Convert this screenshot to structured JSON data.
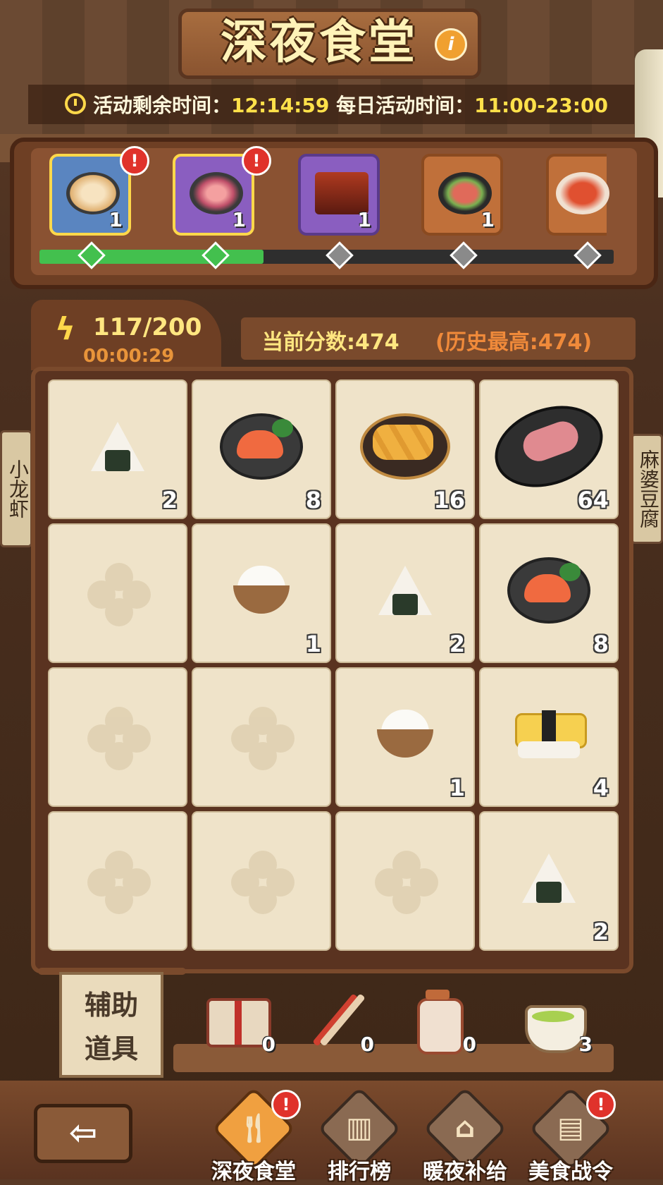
{
  "header": {
    "title": "深夜食堂"
  },
  "timer": {
    "remaining_label": "活动剩余时间：",
    "remaining_value": "12:14:59",
    "daily_label": "每日活动时间：",
    "daily_value": "11:00-23:00"
  },
  "progress": {
    "stages": [
      {
        "dish": "ramen-bowl-icon",
        "count": "1",
        "alert": true,
        "claimed": true
      },
      {
        "dish": "grilled-squid-icon",
        "count": "1",
        "alert": true,
        "claimed": true
      },
      {
        "dish": "unagi-box-icon",
        "count": "1",
        "alert": false,
        "claimed": false
      },
      {
        "dish": "sukiyaki-pot-icon",
        "count": "1",
        "alert": false,
        "claimed": false
      },
      {
        "dish": "lobster-platter-icon",
        "count": "",
        "alert": false,
        "claimed": false
      }
    ],
    "fill_fraction": 0.39
  },
  "energy": {
    "value": "117/200",
    "timer": "00:00:29"
  },
  "score": {
    "current": "当前分数:474",
    "best": "(历史最高:474)"
  },
  "grid": [
    [
      {
        "food": "onigiri-icon",
        "value": "2"
      },
      {
        "food": "salmon-sashimi-icon",
        "value": "8"
      },
      {
        "food": "shrimp-tempura-icon",
        "value": "16"
      },
      {
        "food": "grilled-squid-icon",
        "value": "64"
      }
    ],
    [
      {
        "food": "",
        "value": ""
      },
      {
        "food": "rice-bowl-icon",
        "value": "1"
      },
      {
        "food": "onigiri-icon",
        "value": "2"
      },
      {
        "food": "salmon-sashimi-icon",
        "value": "8"
      }
    ],
    [
      {
        "food": "",
        "value": ""
      },
      {
        "food": "",
        "value": ""
      },
      {
        "food": "rice-bowl-icon",
        "value": "1"
      },
      {
        "food": "tamago-sushi-icon",
        "value": "4"
      }
    ],
    [
      {
        "food": "",
        "value": ""
      },
      {
        "food": "",
        "value": ""
      },
      {
        "food": "",
        "value": ""
      },
      {
        "food": "onigiri-icon",
        "value": "2"
      }
    ]
  ],
  "tools": {
    "label_line1": "辅助",
    "label_line2": "道具",
    "items": [
      {
        "icon": "gift-box-icon",
        "count": "0"
      },
      {
        "icon": "chopsticks-icon",
        "count": "0"
      },
      {
        "icon": "seasoning-jar-icon",
        "count": "0"
      },
      {
        "icon": "matcha-tea-icon",
        "count": "3"
      }
    ]
  },
  "nav": {
    "items": [
      {
        "label": "深夜食堂",
        "icon": "cutlery-icon",
        "alert": true
      },
      {
        "label": "排行榜",
        "icon": "podium-icon",
        "alert": false
      },
      {
        "label": "暖夜补给",
        "icon": "basket-icon",
        "alert": false
      },
      {
        "label": "美食战令",
        "icon": "notebook-icon",
        "alert": true
      }
    ]
  },
  "side_signs": {
    "left": "小龙虾",
    "right": "麻婆豆腐"
  },
  "colors": {
    "accent": "#ffe14a",
    "progress": "#43c04e",
    "alert": "#e0322b",
    "cell": "#efe3c9"
  }
}
